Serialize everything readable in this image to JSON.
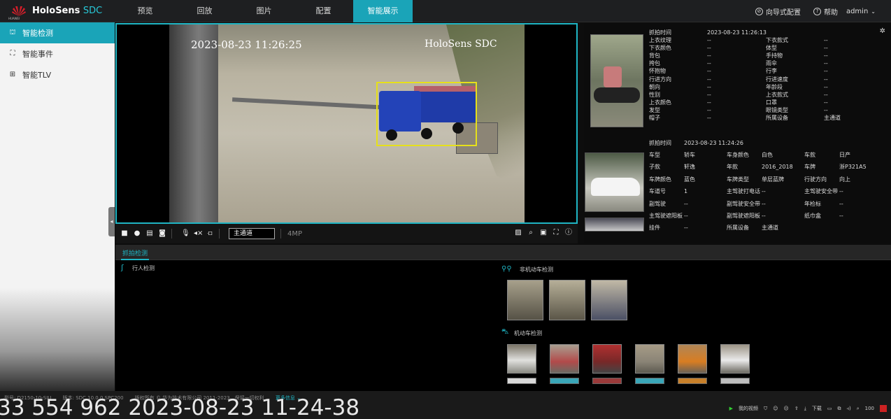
{
  "brand": {
    "vendor": "HUAWEI",
    "name": "HoloSens",
    "suffix": "SDC"
  },
  "nav": [
    "预览",
    "回放",
    "图片",
    "配置",
    "智能展示"
  ],
  "topright": {
    "wizard": "向导式配置",
    "help": "帮助",
    "user": "admin"
  },
  "sidebar": [
    "智能检测",
    "智能事件",
    "智能TLV"
  ],
  "video": {
    "timestamp": "2023-08-23 11:26:25",
    "overlay": "HoloSens SDC"
  },
  "vtool": {
    "channel": "主通道",
    "resolution": "4MP"
  },
  "person": {
    "time_label": "抓拍时间",
    "time_value": "2023-08-23  11:26:13",
    "left": [
      [
        "上衣纹理",
        "--"
      ],
      [
        "下衣颜色",
        "--"
      ],
      [
        "背包",
        "--"
      ],
      [
        "挎包",
        "--"
      ],
      [
        "怀抱物",
        "--"
      ],
      [
        "行进方向",
        "--"
      ],
      [
        "朝向",
        "--"
      ],
      [
        "性别",
        "--"
      ],
      [
        "上衣颜色",
        "--"
      ],
      [
        "发型",
        "--"
      ],
      [
        "帽子",
        "--"
      ]
    ],
    "right": [
      [
        "下衣款式",
        "--"
      ],
      [
        "体型",
        "--"
      ],
      [
        "手持物",
        "--"
      ],
      [
        "雨伞",
        "--"
      ],
      [
        "行李",
        "--"
      ],
      [
        "行进速度",
        "--"
      ],
      [
        "年龄段",
        "--"
      ],
      [
        "上衣款式",
        "--"
      ],
      [
        "口罩",
        "--"
      ],
      [
        "眼镜类型",
        "--"
      ],
      [
        "所属设备",
        "主通道"
      ]
    ]
  },
  "vehicle": {
    "time_label": "抓拍时间",
    "time_value": "2023-08-23  11:24:26",
    "rows": [
      [
        [
          "车型",
          "轿车"
        ],
        [
          "车身颜色",
          "白色"
        ],
        [
          "车款",
          "日产"
        ]
      ],
      [
        [
          "子款",
          "轩逸"
        ],
        [
          "年款",
          "2016_2018"
        ],
        [
          "车牌",
          "浙P321A5"
        ]
      ],
      [
        [
          "车牌颜色",
          "蓝色"
        ],
        [
          "车牌类型",
          "单层蓝牌"
        ],
        [
          "行驶方向",
          "向上"
        ]
      ],
      [
        [
          "车道号",
          "1"
        ],
        [
          "主驾驶打电话",
          "--"
        ],
        [
          "主驾驶安全带",
          "--"
        ]
      ],
      [
        [
          "副驾驶",
          "--"
        ],
        [
          "副驾驶安全带",
          "--"
        ],
        [
          "年检标",
          "--"
        ]
      ],
      [
        [
          "主驾驶遮阳板",
          "--"
        ],
        [
          "副驾驶遮阳板",
          "--"
        ],
        [
          "纸巾盒",
          "--"
        ]
      ],
      [
        [
          "挂件",
          "--"
        ],
        [
          "所属设备",
          "主通道"
        ],
        [
          "",
          ""
        ]
      ]
    ]
  },
  "tabs": {
    "capture": "抓拍检测"
  },
  "sections": {
    "pedestrian": "行人检测",
    "nonmotor": "非机动车检测",
    "motor": "机动车检测"
  },
  "footer": {
    "model": "型号: D2150-10-SIU",
    "version": "版本: SDC 10.0.0.SPC200",
    "copyright": "版权所有 © 华为技术有限公司 2011-2023。保留一切权利",
    "more": "更多信息 ⌄"
  },
  "stamp": "33 554 962 2023-08-23 11-24-38",
  "taskbar": {
    "myvideo": "我的视频",
    "download": "下载",
    "zoom": "100"
  }
}
